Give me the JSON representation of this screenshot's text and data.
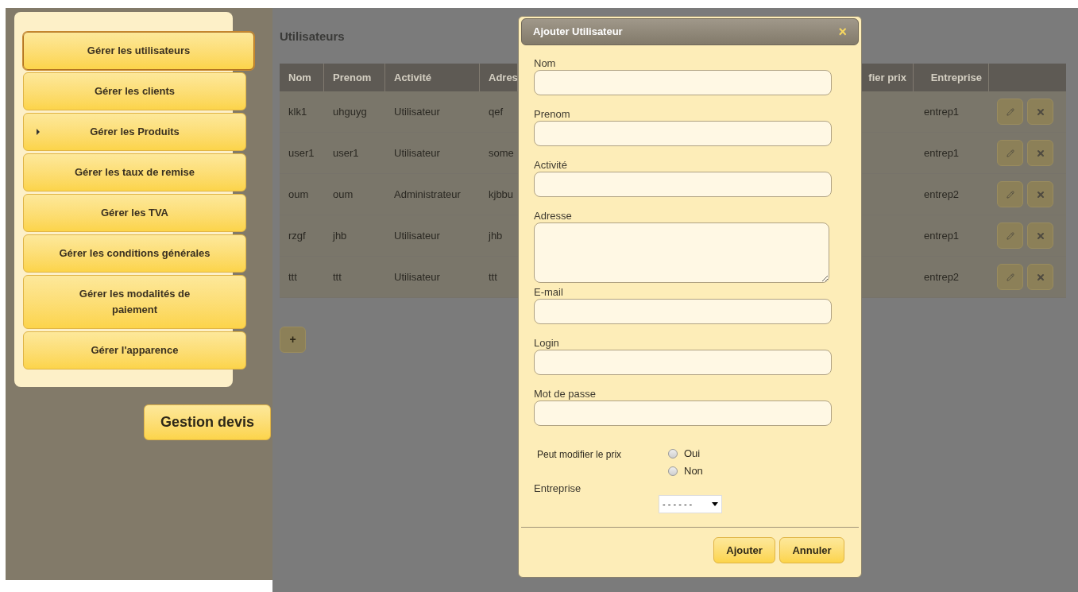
{
  "sidebar": {
    "items": [
      {
        "label": "Gérer les utilisateurs",
        "selected": true,
        "pointer": false
      },
      {
        "label": "Gérer les clients",
        "selected": false,
        "pointer": false
      },
      {
        "label": "Gérer les Produits",
        "selected": false,
        "pointer": true
      },
      {
        "label": "Gérer les taux de remise",
        "selected": false,
        "pointer": false
      },
      {
        "label": "Gérer les TVA",
        "selected": false,
        "pointer": false
      },
      {
        "label": "Gérer les conditions générales",
        "selected": false,
        "pointer": false
      },
      {
        "label": "Gérer les modalités de paiement",
        "selected": false,
        "pointer": false
      },
      {
        "label": "Gérer l'apparence",
        "selected": false,
        "pointer": false
      }
    ],
    "button": "Gestion devis"
  },
  "page": {
    "title": "Utilisateurs",
    "table": {
      "left_columns": [
        "Nom",
        "Prenom",
        "Activité",
        "Adres"
      ],
      "right_columns": [
        "fier prix",
        "Entreprise"
      ],
      "rows": [
        {
          "left": [
            "klk1",
            "uhguyg",
            "Utilisateur",
            "qef"
          ],
          "right": [
            "entrep1"
          ]
        },
        {
          "left": [
            "user1",
            "user1",
            "Utilisateur",
            "some"
          ],
          "right": [
            "entrep1"
          ]
        },
        {
          "left": [
            "oum",
            "oum",
            "Administrateur",
            "kjbbu"
          ],
          "right": [
            "entrep2"
          ]
        },
        {
          "left": [
            "rzgf",
            "jhb",
            "Utilisateur",
            "jhb"
          ],
          "right": [
            "entrep1"
          ]
        },
        {
          "left": [
            "ttt",
            "ttt",
            "Utilisateur",
            "ttt"
          ],
          "right": [
            "entrep2"
          ]
        }
      ]
    },
    "add_button": "+"
  },
  "dialog": {
    "title": "Ajouter Utilisateur",
    "close": "×",
    "fields": [
      {
        "label": "Nom",
        "kind": "text"
      },
      {
        "label": "Prenom",
        "kind": "text"
      },
      {
        "label": "Activité",
        "kind": "text"
      },
      {
        "label": "Adresse",
        "kind": "textarea"
      },
      {
        "label": "E-mail",
        "kind": "text"
      },
      {
        "label": "Login",
        "kind": "text"
      },
      {
        "label": "Mot de passe",
        "kind": "text"
      }
    ],
    "price_label": "Peut modifier le prix",
    "options": [
      {
        "label": "Oui",
        "selected": false
      },
      {
        "label": "Non",
        "selected": false
      }
    ],
    "company_label": "Entreprise",
    "company_value": "- - - - - -",
    "buttons": [
      "Ajouter",
      "Annuler"
    ]
  }
}
